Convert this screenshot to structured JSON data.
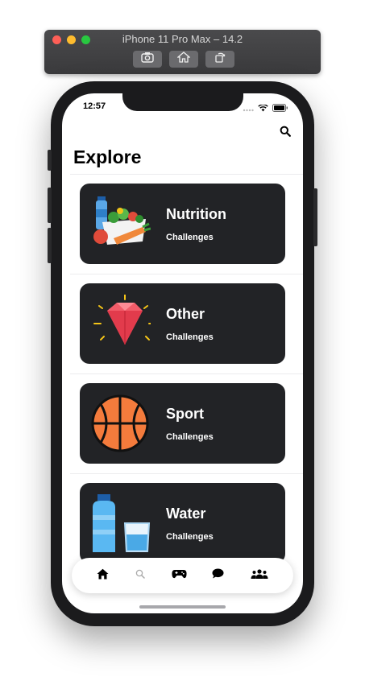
{
  "window": {
    "title": "iPhone 11 Pro Max – 14.2",
    "toolbar": [
      {
        "icon": "screenshot-icon"
      },
      {
        "icon": "home-icon"
      },
      {
        "icon": "rotate-icon"
      }
    ]
  },
  "status_bar": {
    "time": "12:57"
  },
  "header": {
    "title": "Explore",
    "search_icon": "search-icon"
  },
  "categories": [
    {
      "title": "Nutrition",
      "subtitle": "Challenges",
      "icon": "nutrition-icon"
    },
    {
      "title": "Other",
      "subtitle": "Challenges",
      "icon": "diamond-icon"
    },
    {
      "title": "Sport",
      "subtitle": "Challenges",
      "icon": "basketball-icon"
    },
    {
      "title": "Water",
      "subtitle": "Challenges",
      "icon": "water-bottle-icon"
    }
  ],
  "tab_bar": [
    {
      "icon": "home-icon",
      "active": true
    },
    {
      "icon": "search-icon",
      "active": false
    },
    {
      "icon": "gamepad-icon",
      "active": false
    },
    {
      "icon": "chat-icon",
      "active": false
    },
    {
      "icon": "users-icon",
      "active": false
    }
  ],
  "colors": {
    "card_bg": "#222326",
    "accent": "#000000"
  }
}
